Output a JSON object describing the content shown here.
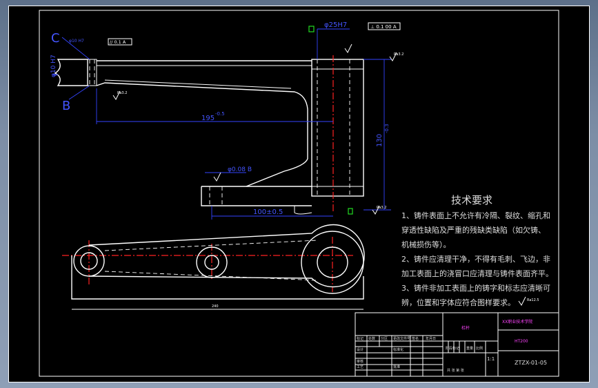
{
  "drawing": {
    "dimensions": {
      "diameter_top": "φ25H7",
      "tolerance_top": "⊥ 0.1 00 A",
      "length_195": "195",
      "length_195_tol": "-0.5",
      "height_130": "130",
      "height_130_tol": "-0.3",
      "diameter_bottom": "φ0.08 B",
      "length_100": "100±0.5",
      "flat_tol": "// 0.1 A",
      "bottom_len": "240",
      "left_tiny": "φ10 H7"
    },
    "labels": {
      "datum_c": "C",
      "datum_b": "B",
      "datum_a": "A",
      "rough_1": "Ra3.2",
      "rough_2": "Ra3.2",
      "rough_3": "Ra3.2",
      "rough_4": "Ra3.2",
      "rough_5": "Ra3.2",
      "rough_6": "Ra3.2"
    }
  },
  "tech_req": {
    "title": "技术要求",
    "lines": [
      "1、铸件表面上不允许有冷隔、裂纹、缩孔和",
      "穿透性缺陷及严重的残缺类缺陷（如欠铸、",
      "机械损伤等）。",
      "2、铸件应清理干净，不得有毛刺、飞边，非",
      "加工表面上的浇冒口应清理与铸件表面齐平。",
      "3、铸件非加工表面上的铸字和标志应清晰可",
      "辨，位置和字体应符合图样要求。"
    ],
    "rough_note": "Ra12.5"
  },
  "title_block": {
    "school": "XX职业技术学院",
    "material": "HT200",
    "drawing_no": "ZTZX-01-05",
    "scale": "1:1",
    "row_labels": [
      "标记",
      "处数",
      "分区",
      "更改文件号",
      "签名",
      "年月日"
    ],
    "design": "设计",
    "std": "标准化",
    "check": "审核",
    "process": "工艺",
    "approve": "批准",
    "stage": "阶段标记",
    "weight": "重量",
    "ratio": "比例",
    "sheet": "共 张 第 张",
    "part_name": "杠杆"
  },
  "colors": {
    "background": "#000000",
    "geometry": "#ffffff",
    "dimension": "#3344ff",
    "centerline": "#ff2222",
    "marker": "#22dd22",
    "title_highlight": "#ff44ff"
  }
}
